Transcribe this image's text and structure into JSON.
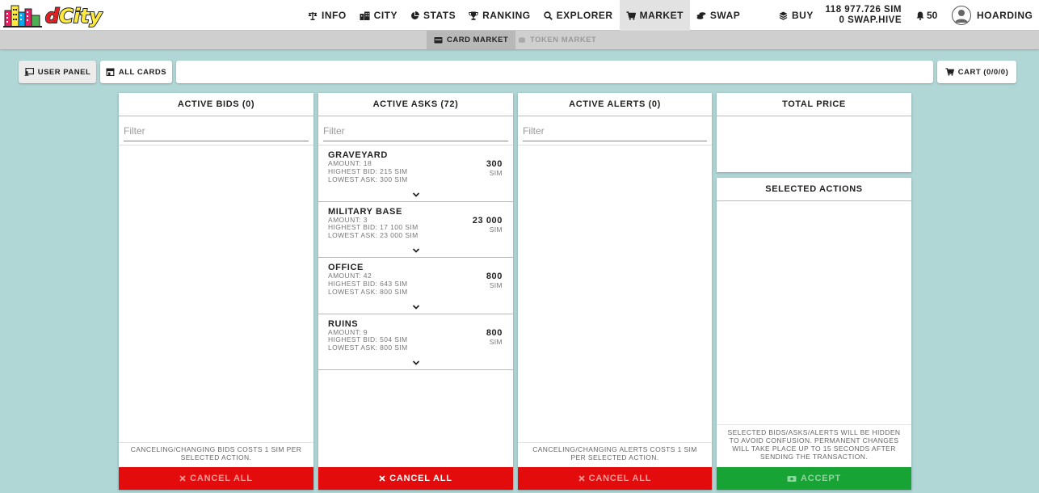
{
  "header": {
    "nav": [
      {
        "label": "INFO",
        "icon": "balance-scale-icon"
      },
      {
        "label": "CITY",
        "icon": "city-icon"
      },
      {
        "label": "STATS",
        "icon": "pie-chart-icon"
      },
      {
        "label": "RANKING",
        "icon": "trophy-icon"
      },
      {
        "label": "EXPLORER",
        "icon": "search-icon"
      },
      {
        "label": "MARKET",
        "icon": "cart-icon",
        "active": true
      },
      {
        "label": "SWAP",
        "icon": "coins-icon"
      },
      {
        "label": "BUY",
        "icon": "layers-icon"
      }
    ],
    "balance_sim": "118 977.726 SIM",
    "balance_hive": "0 SWAP.HIVE",
    "notifications": "50",
    "username": "HOARDING"
  },
  "subnav": {
    "card_market": "CARD MARKET",
    "token_market": "TOKEN MARKET"
  },
  "toolbar": {
    "user_panel": "USER PANEL",
    "all_cards": "ALL CARDS",
    "cart": "CART (0/0/0)"
  },
  "bids": {
    "title": "ACTIVE BIDS (0)",
    "filter_placeholder": "Filter",
    "note": "CANCELING/CHANGING BIDS COSTS 1 SIM PER SELECTED ACTION.",
    "button": "CANCEL ALL"
  },
  "asks": {
    "title": "ACTIVE ASKS (72)",
    "filter_placeholder": "Filter",
    "button": "CANCEL ALL",
    "items": [
      {
        "name": "GRAVEYARD",
        "amount": "AMOUNT: 18",
        "highest": "HIGHEST BID: 215 SIM",
        "lowest": "LOWEST ASK: 300 SIM",
        "price": "300",
        "unit": "SIM"
      },
      {
        "name": "MILITARY BASE",
        "amount": "AMOUNT: 3",
        "highest": "HIGHEST BID: 17 100 SIM",
        "lowest": "LOWEST ASK: 23 000 SIM",
        "price": "23 000",
        "unit": "SIM"
      },
      {
        "name": "OFFICE",
        "amount": "AMOUNT: 42",
        "highest": "HIGHEST BID: 643 SIM",
        "lowest": "LOWEST ASK: 800 SIM",
        "price": "800",
        "unit": "SIM"
      },
      {
        "name": "RUINS",
        "amount": "AMOUNT: 9",
        "highest": "HIGHEST BID: 504 SIM",
        "lowest": "LOWEST ASK: 800 SIM",
        "price": "800",
        "unit": "SIM"
      }
    ]
  },
  "alerts": {
    "title": "ACTIVE ALERTS (0)",
    "filter_placeholder": "Filter",
    "note": "CANCELING/CHANGING ALERTS COSTS 1 SIM PER SELECTED ACTION.",
    "button": "CANCEL ALL"
  },
  "total": {
    "title": "TOTAL PRICE"
  },
  "selected": {
    "title": "SELECTED ACTIONS",
    "note": "SELECTED BIDS/ASKS/ALERTS WILL BE HIDDEN TO AVOID CONFUSION. PERMANENT CHANGES WILL TAKE PLACE UP TO 15 SECONDS AFTER SENDING THE TRANSACTION.",
    "button": "ACCEPT"
  },
  "colors": {
    "background": "#b0d6d6",
    "cancel_red": "#e30b0b",
    "accept_green": "#17a434"
  }
}
